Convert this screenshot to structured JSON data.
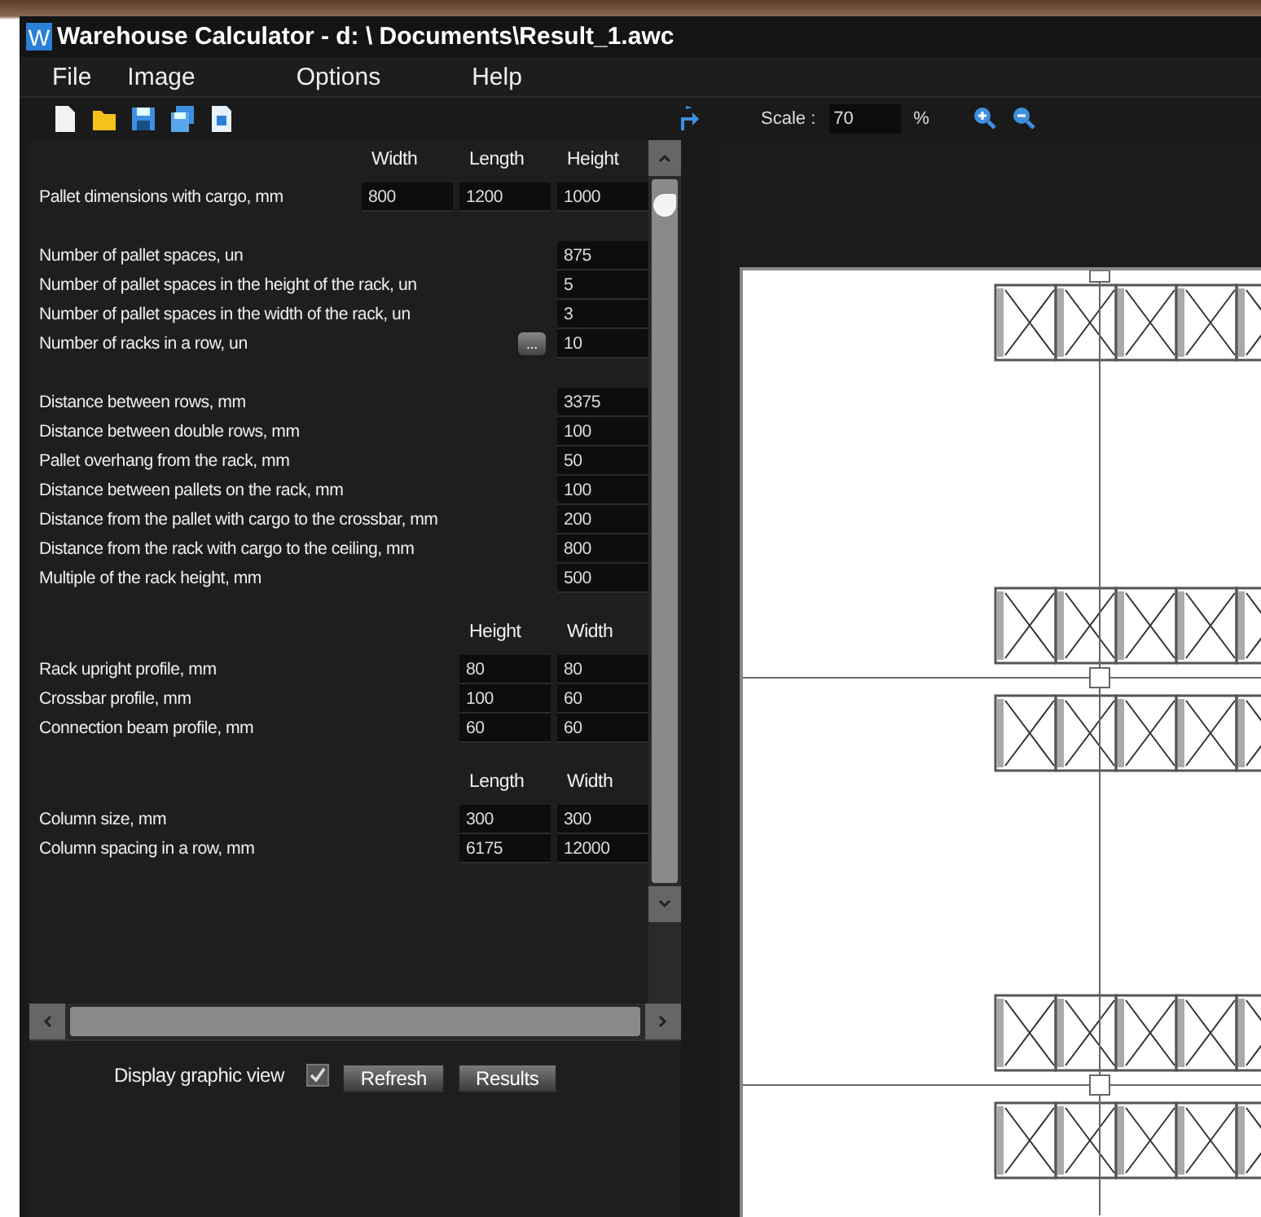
{
  "window": {
    "app_letter": "W",
    "title": "Warehouse Calculator - d: \\ Documents\\Result_1.awc"
  },
  "menu": [
    "File",
    "Image",
    "Options",
    "Help"
  ],
  "toolbar": {
    "scale_label": "Scale :",
    "scale_value": "70",
    "scale_unit": "%"
  },
  "parameters": {
    "sections": [
      {
        "columns": [
          "Width",
          "Length",
          "Height"
        ],
        "rows": [
          {
            "kind": "plain",
            "label": "Pallet dimensions with cargo, mm",
            "values": [
              "800",
              "1200",
              "1000"
            ]
          }
        ]
      },
      {
        "rows": [
          {
            "kind": "plain",
            "label": "Number of pallet spaces, un",
            "values": [
              "875"
            ]
          },
          {
            "kind": "plain",
            "label": "Number of pallet spaces in the height of the rack, un",
            "values": [
              "5"
            ]
          },
          {
            "kind": "plain",
            "label": "Number of pallet spaces in the width of the rack, un",
            "values": [
              "3"
            ]
          },
          {
            "kind": "with_button",
            "label": "Number of racks in a row, un",
            "button": "...",
            "values": [
              "10"
            ]
          }
        ]
      },
      {
        "rows": [
          {
            "kind": "plain",
            "label": "Distance between rows, mm",
            "values": [
              "3375"
            ]
          },
          {
            "kind": "plain",
            "label": "Distance between double rows, mm",
            "values": [
              "100"
            ]
          },
          {
            "kind": "plain",
            "label": "Pallet overhang from the rack, mm",
            "values": [
              "50"
            ]
          },
          {
            "kind": "plain",
            "label": "Distance between pallets on the rack, mm",
            "values": [
              "100"
            ]
          },
          {
            "kind": "plain",
            "label": "Distance from the pallet with cargo to the crossbar, mm",
            "values": [
              "200"
            ]
          },
          {
            "kind": "plain",
            "label": "Distance from the rack with cargo to the ceiling, mm",
            "values": [
              "800"
            ]
          },
          {
            "kind": "plain",
            "label": "Multiple of the rack height, mm",
            "values": [
              "500"
            ]
          }
        ]
      },
      {
        "columns": [
          "Height",
          "Width"
        ],
        "rows": [
          {
            "kind": "plain",
            "label": "Rack upright profile, mm",
            "values": [
              "80",
              "80"
            ]
          },
          {
            "kind": "plain",
            "label": "Crossbar profile, mm",
            "values": [
              "100",
              "60"
            ]
          },
          {
            "kind": "plain",
            "label": "Connection beam profile, mm",
            "values": [
              "60",
              "60"
            ]
          }
        ]
      },
      {
        "columns": [
          "Length",
          "Width"
        ],
        "rows": [
          {
            "kind": "plain",
            "label": "Column size, mm",
            "values": [
              "300",
              "300"
            ]
          },
          {
            "kind": "plain",
            "label": "Column spacing in a row, mm",
            "values": [
              "6175",
              "12000"
            ]
          }
        ]
      }
    ]
  },
  "bottom": {
    "display_label": "Display graphic view",
    "display_checked": true,
    "buttons": [
      "Refresh",
      "Results"
    ]
  }
}
